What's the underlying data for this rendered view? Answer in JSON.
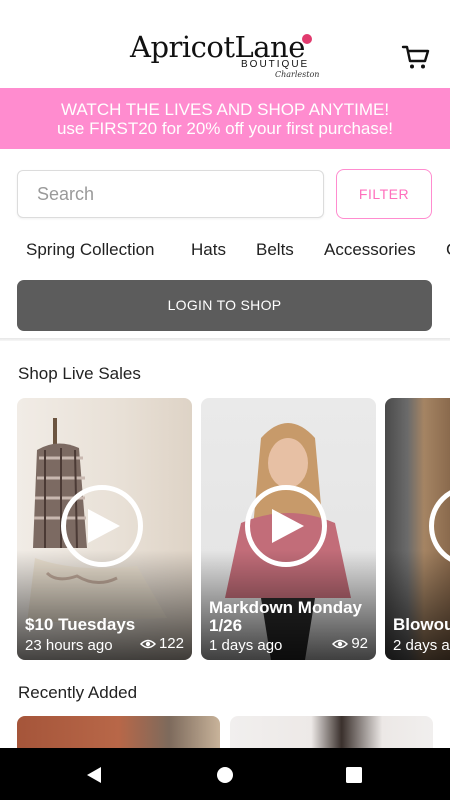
{
  "header": {
    "logo_main": "ApricotLane",
    "logo_sub": "BOUTIQUE",
    "logo_city": "Charleston",
    "cart_icon": "cart-icon"
  },
  "banner": {
    "line1": "WATCH THE LIVES AND SHOP ANYTIME!",
    "line2": "use FIRST20 for 20% off your first purchase!"
  },
  "search": {
    "placeholder": "Search",
    "value": ""
  },
  "filter_label": "FILTER",
  "categories": [
    "Spring Collection",
    "Hats",
    "Belts",
    "Accessories",
    "C"
  ],
  "login_label": "LOGIN TO SHOP",
  "live_sales": {
    "title": "Shop Live Sales",
    "cards": [
      {
        "title": "$10 Tuesdays",
        "time": "23 hours ago",
        "views": "122"
      },
      {
        "title": "Markdown Monday 1/26",
        "time": "1 days ago",
        "views": "92"
      },
      {
        "title": "Blowou",
        "time": "2 days a",
        "views": ""
      }
    ]
  },
  "recently_added": {
    "title": "Recently Added"
  },
  "colors": {
    "brand_pink": "#ff8ccf",
    "button_gray": "#5c5c5c"
  }
}
